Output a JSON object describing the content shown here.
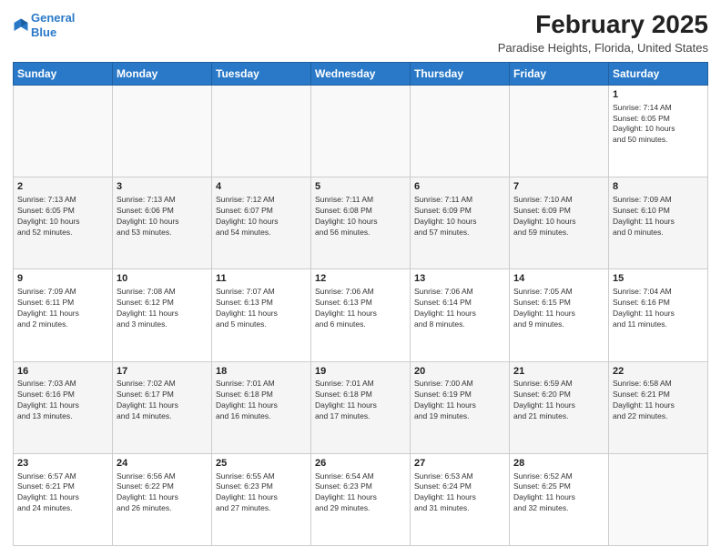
{
  "header": {
    "logo_line1": "General",
    "logo_line2": "Blue",
    "month": "February 2025",
    "location": "Paradise Heights, Florida, United States"
  },
  "weekdays": [
    "Sunday",
    "Monday",
    "Tuesday",
    "Wednesday",
    "Thursday",
    "Friday",
    "Saturday"
  ],
  "weeks": [
    [
      {
        "day": "",
        "info": ""
      },
      {
        "day": "",
        "info": ""
      },
      {
        "day": "",
        "info": ""
      },
      {
        "day": "",
        "info": ""
      },
      {
        "day": "",
        "info": ""
      },
      {
        "day": "",
        "info": ""
      },
      {
        "day": "1",
        "info": "Sunrise: 7:14 AM\nSunset: 6:05 PM\nDaylight: 10 hours\nand 50 minutes."
      }
    ],
    [
      {
        "day": "2",
        "info": "Sunrise: 7:13 AM\nSunset: 6:05 PM\nDaylight: 10 hours\nand 52 minutes."
      },
      {
        "day": "3",
        "info": "Sunrise: 7:13 AM\nSunset: 6:06 PM\nDaylight: 10 hours\nand 53 minutes."
      },
      {
        "day": "4",
        "info": "Sunrise: 7:12 AM\nSunset: 6:07 PM\nDaylight: 10 hours\nand 54 minutes."
      },
      {
        "day": "5",
        "info": "Sunrise: 7:11 AM\nSunset: 6:08 PM\nDaylight: 10 hours\nand 56 minutes."
      },
      {
        "day": "6",
        "info": "Sunrise: 7:11 AM\nSunset: 6:09 PM\nDaylight: 10 hours\nand 57 minutes."
      },
      {
        "day": "7",
        "info": "Sunrise: 7:10 AM\nSunset: 6:09 PM\nDaylight: 10 hours\nand 59 minutes."
      },
      {
        "day": "8",
        "info": "Sunrise: 7:09 AM\nSunset: 6:10 PM\nDaylight: 11 hours\nand 0 minutes."
      }
    ],
    [
      {
        "day": "9",
        "info": "Sunrise: 7:09 AM\nSunset: 6:11 PM\nDaylight: 11 hours\nand 2 minutes."
      },
      {
        "day": "10",
        "info": "Sunrise: 7:08 AM\nSunset: 6:12 PM\nDaylight: 11 hours\nand 3 minutes."
      },
      {
        "day": "11",
        "info": "Sunrise: 7:07 AM\nSunset: 6:13 PM\nDaylight: 11 hours\nand 5 minutes."
      },
      {
        "day": "12",
        "info": "Sunrise: 7:06 AM\nSunset: 6:13 PM\nDaylight: 11 hours\nand 6 minutes."
      },
      {
        "day": "13",
        "info": "Sunrise: 7:06 AM\nSunset: 6:14 PM\nDaylight: 11 hours\nand 8 minutes."
      },
      {
        "day": "14",
        "info": "Sunrise: 7:05 AM\nSunset: 6:15 PM\nDaylight: 11 hours\nand 9 minutes."
      },
      {
        "day": "15",
        "info": "Sunrise: 7:04 AM\nSunset: 6:16 PM\nDaylight: 11 hours\nand 11 minutes."
      }
    ],
    [
      {
        "day": "16",
        "info": "Sunrise: 7:03 AM\nSunset: 6:16 PM\nDaylight: 11 hours\nand 13 minutes."
      },
      {
        "day": "17",
        "info": "Sunrise: 7:02 AM\nSunset: 6:17 PM\nDaylight: 11 hours\nand 14 minutes."
      },
      {
        "day": "18",
        "info": "Sunrise: 7:01 AM\nSunset: 6:18 PM\nDaylight: 11 hours\nand 16 minutes."
      },
      {
        "day": "19",
        "info": "Sunrise: 7:01 AM\nSunset: 6:18 PM\nDaylight: 11 hours\nand 17 minutes."
      },
      {
        "day": "20",
        "info": "Sunrise: 7:00 AM\nSunset: 6:19 PM\nDaylight: 11 hours\nand 19 minutes."
      },
      {
        "day": "21",
        "info": "Sunrise: 6:59 AM\nSunset: 6:20 PM\nDaylight: 11 hours\nand 21 minutes."
      },
      {
        "day": "22",
        "info": "Sunrise: 6:58 AM\nSunset: 6:21 PM\nDaylight: 11 hours\nand 22 minutes."
      }
    ],
    [
      {
        "day": "23",
        "info": "Sunrise: 6:57 AM\nSunset: 6:21 PM\nDaylight: 11 hours\nand 24 minutes."
      },
      {
        "day": "24",
        "info": "Sunrise: 6:56 AM\nSunset: 6:22 PM\nDaylight: 11 hours\nand 26 minutes."
      },
      {
        "day": "25",
        "info": "Sunrise: 6:55 AM\nSunset: 6:23 PM\nDaylight: 11 hours\nand 27 minutes."
      },
      {
        "day": "26",
        "info": "Sunrise: 6:54 AM\nSunset: 6:23 PM\nDaylight: 11 hours\nand 29 minutes."
      },
      {
        "day": "27",
        "info": "Sunrise: 6:53 AM\nSunset: 6:24 PM\nDaylight: 11 hours\nand 31 minutes."
      },
      {
        "day": "28",
        "info": "Sunrise: 6:52 AM\nSunset: 6:25 PM\nDaylight: 11 hours\nand 32 minutes."
      },
      {
        "day": "",
        "info": ""
      }
    ]
  ]
}
